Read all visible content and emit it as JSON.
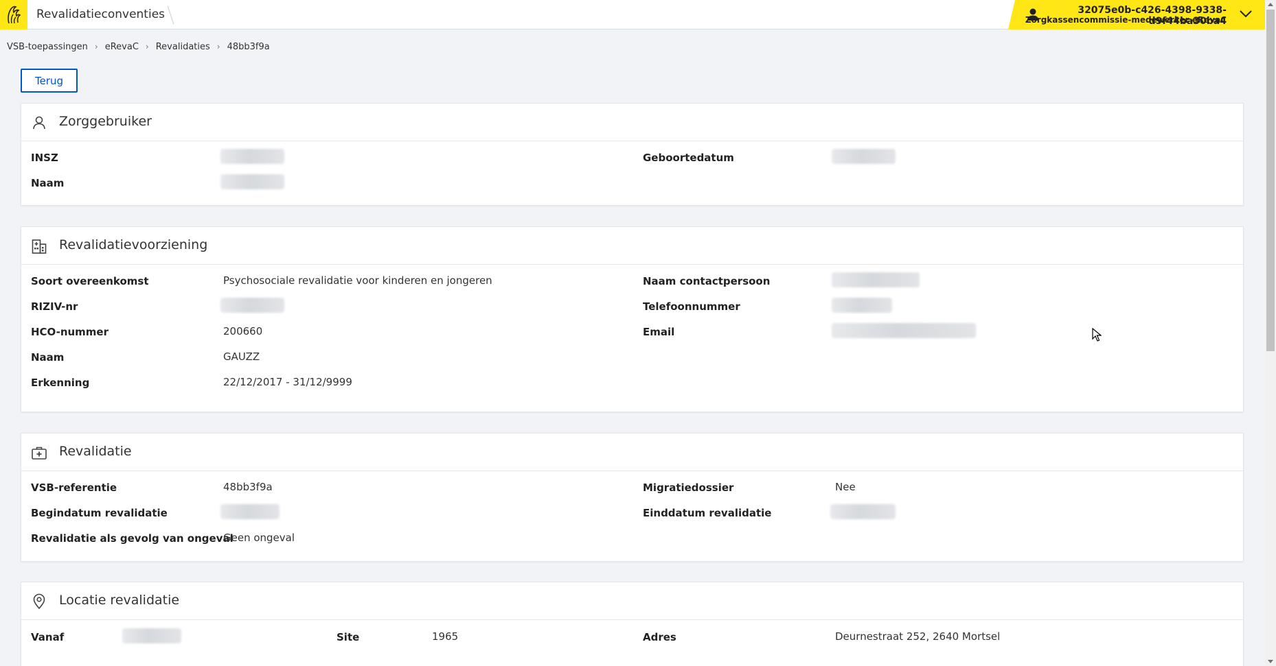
{
  "header": {
    "app_title": "Revalidatieconventies",
    "user_id": "32075e0b-c426-4398-9338-d9f44ba30ba4",
    "user_role": "Zorgkassencommissie-medewerker eRevaC",
    "accent_color": "#ffe615"
  },
  "breadcrumb": [
    "VSB-toepassingen",
    "eRevaC",
    "Revalidaties",
    "48bb3f9a"
  ],
  "back_button": "Terug",
  "zorggebruiker": {
    "title": "Zorggebruiker",
    "icon": "user-icon",
    "insz_label": "INSZ",
    "naam_label": "Naam",
    "geboortedatum_label": "Geboortedatum"
  },
  "revalidatievoorziening": {
    "title": "Revalidatievoorziening",
    "icon": "building-icon",
    "soort_label": "Soort overeenkomst",
    "soort_value": "Psychosociale revalidatie voor kinderen en jongeren",
    "riziv_label": "RIZIV-nr",
    "hco_label": "HCO-nummer",
    "hco_value": "200660",
    "naam_label": "Naam",
    "naam_value": "GAUZZ",
    "erkenning_label": "Erkenning",
    "erkenning_value": "22/12/2017 - 31/12/9999",
    "contactpersoon_label": "Naam contactpersoon",
    "telefoon_label": "Telefoonnummer",
    "email_label": "Email"
  },
  "revalidatie": {
    "title": "Revalidatie",
    "icon": "medical-case-icon",
    "vsb_label": "VSB-referentie",
    "vsb_value": "48bb3f9a",
    "begindatum_label": "Begindatum revalidatie",
    "ongeval_label": "Revalidatie als gevolg van ongeval",
    "ongeval_value": "Geen ongeval",
    "migratie_label": "Migratiedossier",
    "migratie_value": "Nee",
    "einddatum_label": "Einddatum revalidatie"
  },
  "locatie": {
    "title": "Locatie revalidatie",
    "icon": "location-pin-icon",
    "vanaf_label": "Vanaf",
    "site_label": "Site",
    "site_value": "1965",
    "adres_label": "Adres",
    "adres_value": "Deurnestraat 252, 2640 Mortsel"
  }
}
